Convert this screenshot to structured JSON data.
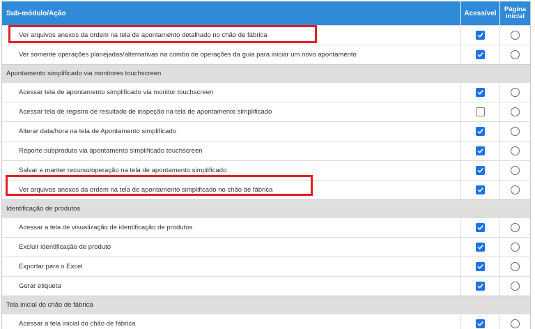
{
  "header": {
    "col_action": "Sub-módulo/Ação",
    "col_accessible": "Acessível",
    "col_home_line1": "Página",
    "col_home_line2": "inicial"
  },
  "rows": [
    {
      "type": "item",
      "label": "Ver arquivos anexos da ordem na tela de apontamento detalhado no chão de fábrica",
      "accessible": true,
      "highlighted": true
    },
    {
      "type": "item",
      "label": "Ver somente operações planejadas/alternativas na combo de operações da guia para iniciar um novo apontamento",
      "accessible": true
    },
    {
      "type": "group",
      "label": "Apontamento simplificado via monitores touchscreen"
    },
    {
      "type": "item",
      "label": "Acessar tela de apontamento simplificado via monitor touchscreen",
      "accessible": true
    },
    {
      "type": "item",
      "label": "Acessar tela de registro de resultado de inspeção na tela de apontamento simplificado",
      "accessible": false
    },
    {
      "type": "item",
      "label": "Alterar data/hora na tela de Apontamento simplificado",
      "accessible": true
    },
    {
      "type": "item",
      "label": "Reporte subproduto via apontamento simplificado touchscreen",
      "accessible": true
    },
    {
      "type": "item",
      "label": "Salvar e manter recurso/operação na tela de apontamento simplificado",
      "accessible": true
    },
    {
      "type": "item",
      "label": "Ver arquivos anexos da ordem na tela de apontamento simplificado no chão de fábrica",
      "accessible": true,
      "highlighted": true
    },
    {
      "type": "group",
      "label": "Identificação de produtos"
    },
    {
      "type": "item",
      "label": "Acessar a tela de visualização de identificação de produtos",
      "accessible": true
    },
    {
      "type": "item",
      "label": "Excluir identificação de produto",
      "accessible": true
    },
    {
      "type": "item",
      "label": "Exportar para o Excel",
      "accessible": true
    },
    {
      "type": "item",
      "label": "Gerar etiqueta",
      "accessible": true
    },
    {
      "type": "group",
      "label": "Tela inicial do chão de fábrica"
    },
    {
      "type": "item",
      "label": "Acessar a tela inicial do chão de fábrica",
      "accessible": true
    }
  ],
  "colors": {
    "header_bg": "#2f8ad8",
    "group_bg": "#dedede",
    "checkbox_on": "#1a73e8",
    "highlight": "#e31e24"
  },
  "icons": {
    "checked": "checkbox-checked-icon",
    "unchecked": "checkbox-unchecked-icon",
    "radio": "radio-icon"
  }
}
